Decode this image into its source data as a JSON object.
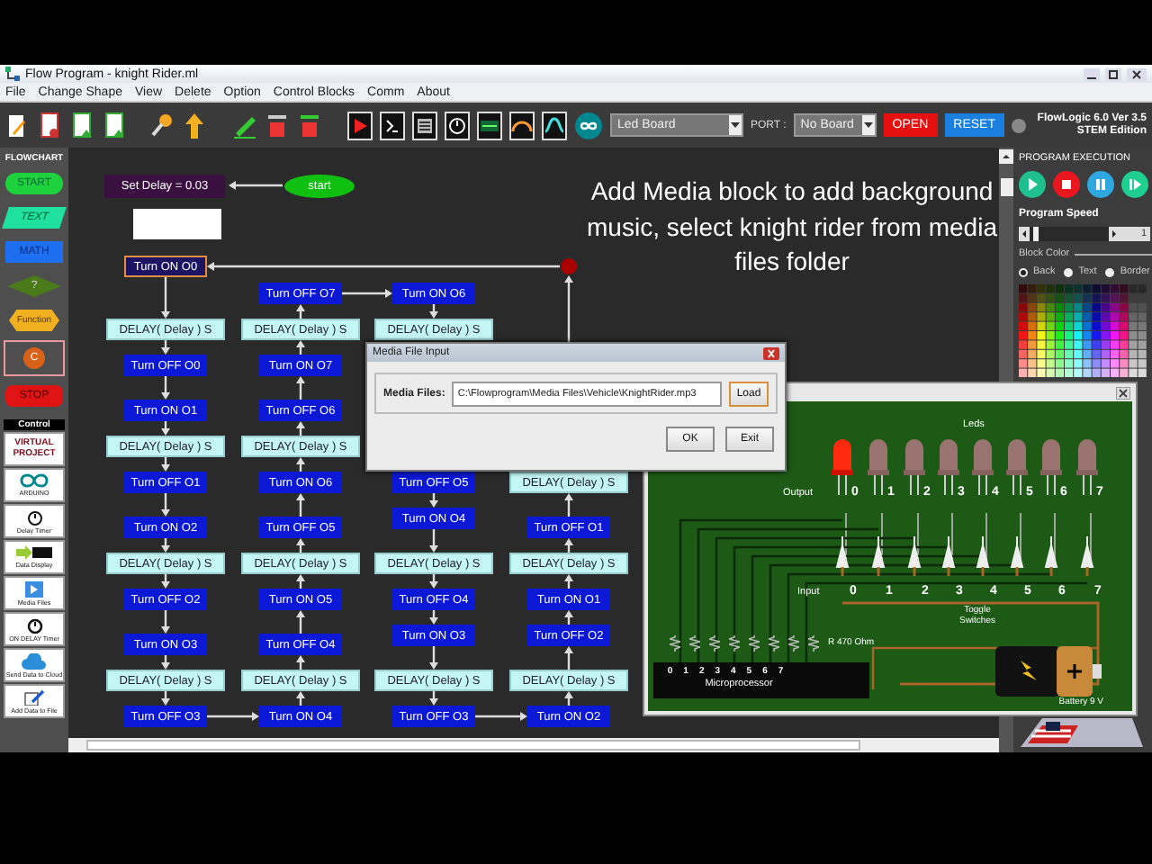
{
  "window": {
    "title": "Flow Program - knight Rider.ml"
  },
  "menu": [
    "File",
    "Change Shape",
    "View",
    "Delete",
    "Option",
    "Control Blocks",
    "Comm",
    "About"
  ],
  "toolbar": {
    "board": "Led Board",
    "port_label": "PORT :",
    "port": "No Board",
    "open": "OPEN",
    "reset": "RESET",
    "product": "FlowLogic 6.0 Ver 3.5",
    "edition": "STEM Edition"
  },
  "sidebar": {
    "heading": "FLOWCHART",
    "shapes": [
      {
        "kind": "start",
        "label": "START",
        "selected": false
      },
      {
        "kind": "text",
        "label": "TEXT",
        "selected": false
      },
      {
        "kind": "math",
        "label": "MATH",
        "selected": false
      },
      {
        "kind": "decision",
        "label": "?",
        "selected": false
      },
      {
        "kind": "function",
        "label": "Function",
        "selected": false
      },
      {
        "kind": "c",
        "label": "C",
        "selected": true
      },
      {
        "kind": "stop",
        "label": "STOP",
        "selected": false
      }
    ],
    "control_heading": "Control",
    "controls": [
      {
        "kind": "virtual",
        "label": "VIRTUAL PROJECT"
      },
      {
        "kind": "arduino",
        "label": "ARDUINO"
      },
      {
        "kind": "timer",
        "label": "Delay Timer"
      },
      {
        "kind": "display",
        "label": "Data Display"
      },
      {
        "kind": "media",
        "label": "Media Files"
      },
      {
        "kind": "ondelay",
        "label": "ON DELAY Timer"
      },
      {
        "kind": "cloud",
        "label": "Send Data to Cloud"
      },
      {
        "kind": "file",
        "label": "Add Data to File"
      }
    ]
  },
  "canvas": {
    "set_delay": "Set Delay = 0.03",
    "start": "start",
    "note": "Add Media block to add background music, select knight rider from media files folder",
    "columns": [
      {
        "flows_up": false,
        "blocks": [
          {
            "kind": "action",
            "label": "Turn ON O0",
            "selected": true
          },
          {
            "kind": "delay",
            "label": "DELAY( Delay ) S",
            "selected": false
          },
          {
            "kind": "action",
            "label": "Turn OFF O0",
            "selected": false
          },
          {
            "kind": "action",
            "label": "Turn ON O1",
            "selected": false
          },
          {
            "kind": "delay",
            "label": "DELAY( Delay ) S",
            "selected": false
          },
          {
            "kind": "action",
            "label": "Turn OFF O1",
            "selected": false
          },
          {
            "kind": "action",
            "label": "Turn ON O2",
            "selected": false
          },
          {
            "kind": "delay",
            "label": "DELAY( Delay ) S",
            "selected": false
          },
          {
            "kind": "action",
            "label": "Turn OFF O2",
            "selected": false
          },
          {
            "kind": "action",
            "label": "Turn ON O3",
            "selected": false
          },
          {
            "kind": "delay",
            "label": "DELAY( Delay ) S",
            "selected": false
          },
          {
            "kind": "action",
            "label": "Turn OFF O3",
            "selected": false
          }
        ]
      },
      {
        "flows_up": true,
        "blocks": [
          {
            "kind": "action",
            "label": "Turn OFF O7",
            "selected": false
          },
          {
            "kind": "delay",
            "label": "DELAY( Delay ) S",
            "selected": false
          },
          {
            "kind": "action",
            "label": "Turn ON O7",
            "selected": false
          },
          {
            "kind": "action",
            "label": "Turn OFF O6",
            "selected": false
          },
          {
            "kind": "delay",
            "label": "DELAY( Delay ) S",
            "selected": false
          },
          {
            "kind": "action",
            "label": "Turn ON O6",
            "selected": false
          },
          {
            "kind": "action",
            "label": "Turn OFF O5",
            "selected": false
          },
          {
            "kind": "delay",
            "label": "DELAY( Delay ) S",
            "selected": false
          },
          {
            "kind": "action",
            "label": "Turn ON O5",
            "selected": false
          },
          {
            "kind": "action",
            "label": "Turn OFF O4",
            "selected": false
          },
          {
            "kind": "delay",
            "label": "DELAY( Delay ) S",
            "selected": false
          },
          {
            "kind": "action",
            "label": "Turn ON O4",
            "selected": false
          }
        ]
      },
      {
        "flows_up": false,
        "blocks": [
          {
            "kind": "action",
            "label": "Turn ON O6",
            "selected": false
          },
          {
            "kind": "delay",
            "label": "DELAY( Delay ) S",
            "selected": false
          },
          {
            "kind": "action",
            "label": "Turn OFF O5",
            "selected": false
          },
          {
            "kind": "action",
            "label": "Turn ON O4",
            "selected": false
          },
          {
            "kind": "delay",
            "label": "DELAY( Delay ) S",
            "selected": false
          },
          {
            "kind": "action",
            "label": "Turn OFF O4",
            "selected": false
          },
          {
            "kind": "action",
            "label": "Turn ON O3",
            "selected": false
          },
          {
            "kind": "delay",
            "label": "DELAY( Delay ) S",
            "selected": false
          },
          {
            "kind": "action",
            "label": "Turn OFF O3",
            "selected": false
          }
        ]
      },
      {
        "flows_up": true,
        "blocks": [
          {
            "kind": "delay",
            "label": "DELAY( Delay ) S",
            "selected": false
          },
          {
            "kind": "action",
            "label": "Turn OFF O1",
            "selected": false
          },
          {
            "kind": "delay",
            "label": "DELAY( Delay ) S",
            "selected": false
          },
          {
            "kind": "action",
            "label": "Turn ON O1",
            "selected": false
          },
          {
            "kind": "action",
            "label": "Turn OFF O2",
            "selected": false
          },
          {
            "kind": "delay",
            "label": "DELAY( Delay ) S",
            "selected": false
          },
          {
            "kind": "action",
            "label": "Turn ON O2",
            "selected": false
          }
        ]
      }
    ]
  },
  "execution": {
    "title": "PROGRAM EXECUTION",
    "speed_label": "Program Speed",
    "speed": {
      "level": 0.05,
      "reading": "1"
    },
    "color_label": "Block Color",
    "color_targets": [
      {
        "label": "Back",
        "selected": true
      },
      {
        "label": "Text",
        "selected": false
      },
      {
        "label": "Border",
        "selected": false
      }
    ]
  },
  "media_dialog": {
    "title": "Media File Input",
    "field_label": "Media Files:",
    "value": "C:\\Flowprogram\\Media Files\\Vehicle\\KnightRider.mp3",
    "buttons": [
      "Load",
      "OK",
      "Exit"
    ]
  },
  "circuit": {
    "leds_label": "Leds",
    "leds": [
      {
        "on": true
      },
      {
        "on": false
      },
      {
        "on": false
      },
      {
        "on": false
      },
      {
        "on": false
      },
      {
        "on": false
      },
      {
        "on": false
      },
      {
        "on": false
      }
    ],
    "output_label": "Output",
    "output_numbers": [
      "0",
      "1",
      "2",
      "3",
      "4",
      "5",
      "6",
      "7"
    ],
    "input_label": "Input",
    "input_numbers": [
      "0",
      "1",
      "2",
      "3",
      "4",
      "5",
      "6",
      "7"
    ],
    "switches_label": "Toggle Switches",
    "resistor_label": "R 470 Ohm",
    "chip_pins": [
      "0",
      "1",
      "2",
      "3",
      "4",
      "5",
      "6",
      "7"
    ],
    "chip_label": "Microprocessor",
    "battery_label": "Battery 9 V"
  }
}
